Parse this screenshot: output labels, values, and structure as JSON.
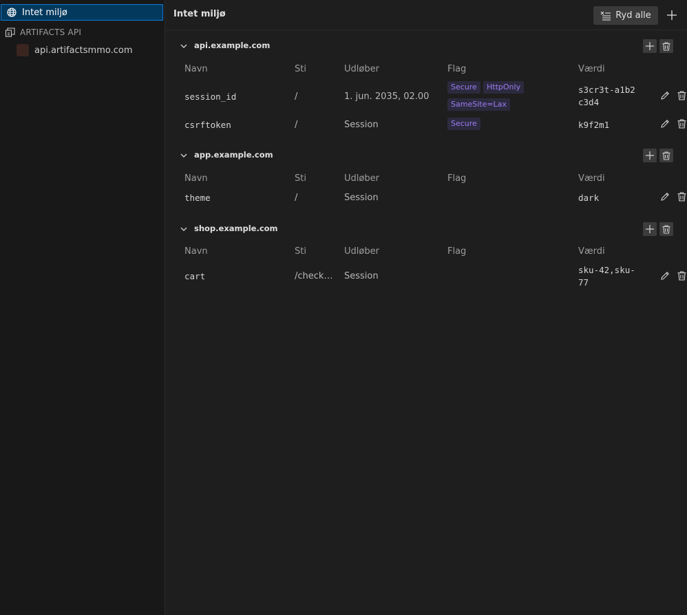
{
  "sidebar": {
    "environment": {
      "label": "Intet miljø",
      "icon": "globe-icon"
    },
    "group": {
      "label": "ARTIFACTS API",
      "icon": "collection-icon"
    },
    "child": {
      "label": "api.artifactsmmo.com"
    }
  },
  "header": {
    "title": "Intet miljø",
    "clear_all_label": "Ryd alle",
    "add_icon": "plus-icon"
  },
  "columns": {
    "name": "Navn",
    "path": "Sti",
    "expires": "Udløber",
    "flags": "Flag",
    "value": "Værdi"
  },
  "sections": [
    {
      "domain": "api.example.com",
      "rows": [
        {
          "name": "session_id",
          "path": "/",
          "expires": "1. jun. 2035, 02.00",
          "flags": [
            "Secure",
            "HttpOnly",
            "SameSite=Lax"
          ],
          "value": "s3cr3t-a1b2c3d4"
        },
        {
          "name": "csrftoken",
          "path": "/",
          "expires": "Session",
          "flags": [
            "Secure"
          ],
          "value": "k9f2m1"
        }
      ]
    },
    {
      "domain": "app.example.com",
      "rows": [
        {
          "name": "theme",
          "path": "/",
          "expires": "Session",
          "flags": [],
          "value": "dark"
        }
      ]
    },
    {
      "domain": "shop.example.com",
      "rows": [
        {
          "name": "cart",
          "path": "/check…",
          "expires": "Session",
          "flags": [],
          "value": "sku-42,sku-77"
        }
      ]
    }
  ],
  "colors": {
    "accent": "#0e7ad3",
    "selected_bg": "#04395e",
    "badge_text": "#9c7cf2",
    "badge_bg": "#2c2a3e"
  }
}
